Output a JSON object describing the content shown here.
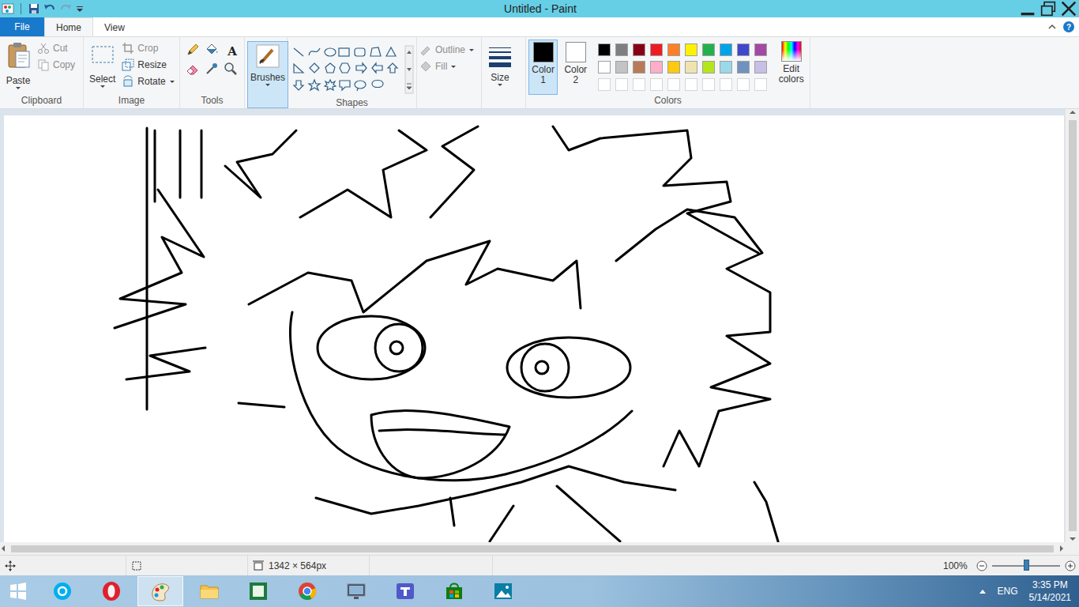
{
  "window": {
    "title": "Untitled - Paint"
  },
  "tabs": [
    {
      "label": "File",
      "selected": false
    },
    {
      "label": "Home",
      "selected": true
    },
    {
      "label": "View",
      "selected": false
    }
  ],
  "ribbon": {
    "help": "?"
  },
  "clipboard": {
    "label": "Clipboard",
    "paste": "Paste",
    "cut": {
      "label": "Cut",
      "disabled": true
    },
    "copy": {
      "label": "Copy",
      "disabled": true
    }
  },
  "image": {
    "label": "Image",
    "select": "Select",
    "crop": {
      "label": "Crop",
      "disabled": true
    },
    "resize": {
      "label": "Resize",
      "disabled": false
    },
    "rotate": {
      "label": "Rotate",
      "disabled": false
    }
  },
  "tools": {
    "label": "Tools",
    "text_tool": "A"
  },
  "brushes": {
    "label": "Brushes",
    "selected": true
  },
  "shapes": {
    "label": "Shapes",
    "outline": {
      "label": "Outline",
      "disabled": true
    },
    "fill": {
      "label": "Fill",
      "disabled": true
    }
  },
  "size": {
    "label": "Size"
  },
  "colors": {
    "label": "Colors",
    "color1": {
      "label": "Color",
      "number": "1",
      "color": "#000000",
      "selected": true
    },
    "color2": {
      "label": "Color",
      "number": "2",
      "color": "#ffffff",
      "selected": false
    },
    "edit": "Edit colors",
    "palette": [
      {
        "color": "#000000",
        "kind": "swatch"
      },
      {
        "color": "#7f7f7f",
        "kind": "swatch"
      },
      {
        "color": "#880015",
        "kind": "swatch"
      },
      {
        "color": "#ed1c24",
        "kind": "swatch"
      },
      {
        "color": "#ff7f27",
        "kind": "swatch"
      },
      {
        "color": "#fff200",
        "kind": "swatch"
      },
      {
        "color": "#22b14c",
        "kind": "swatch"
      },
      {
        "color": "#00a2e8",
        "kind": "swatch"
      },
      {
        "color": "#3f48cc",
        "kind": "swatch"
      },
      {
        "color": "#a349a4",
        "kind": "swatch"
      },
      {
        "color": "#ffffff",
        "kind": "swatch"
      },
      {
        "color": "#c3c3c3",
        "kind": "swatch"
      },
      {
        "color": "#b97a57",
        "kind": "swatch"
      },
      {
        "color": "#ffaec9",
        "kind": "swatch"
      },
      {
        "color": "#ffc90e",
        "kind": "swatch"
      },
      {
        "color": "#efe4b0",
        "kind": "swatch"
      },
      {
        "color": "#b5e61d",
        "kind": "swatch"
      },
      {
        "color": "#99d9ea",
        "kind": "swatch"
      },
      {
        "color": "#7092be",
        "kind": "swatch"
      },
      {
        "color": "#c8bfe7",
        "kind": "swatch"
      },
      {
        "color": "#ffffff",
        "kind": "empty"
      },
      {
        "color": "#ffffff",
        "kind": "empty"
      },
      {
        "color": "#ffffff",
        "kind": "empty"
      },
      {
        "color": "#ffffff",
        "kind": "empty"
      },
      {
        "color": "#ffffff",
        "kind": "empty"
      },
      {
        "color": "#ffffff",
        "kind": "empty"
      },
      {
        "color": "#ffffff",
        "kind": "empty"
      },
      {
        "color": "#ffffff",
        "kind": "empty"
      },
      {
        "color": "#ffffff",
        "kind": "empty"
      },
      {
        "color": "#ffffff",
        "kind": "empty"
      }
    ]
  },
  "status_bar": {
    "canvas_size": "1342 × 564px",
    "zoom": "100%",
    "zoom_level": 0.5
  },
  "taskbar": {
    "apps": [
      {
        "kind": "skype",
        "selected": false
      },
      {
        "kind": "opera",
        "selected": false
      },
      {
        "kind": "paint",
        "selected": true
      },
      {
        "kind": "explorer",
        "selected": false
      },
      {
        "kind": "app",
        "selected": false
      },
      {
        "kind": "chrome",
        "selected": false
      },
      {
        "kind": "display",
        "selected": false
      },
      {
        "kind": "teams",
        "selected": false
      },
      {
        "kind": "store",
        "selected": false
      },
      {
        "kind": "photos",
        "selected": false
      }
    ],
    "language": "ENG",
    "time": "3:35 PM",
    "date": "5/14/2021"
  }
}
